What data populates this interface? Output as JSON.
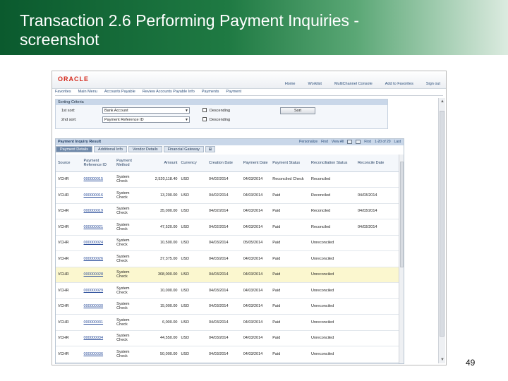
{
  "slide": {
    "title_line1": "Transaction 2.6 Performing Payment Inquiries -",
    "title_line2": "screenshot",
    "page_number": "49"
  },
  "app": {
    "logo": "ORACLE",
    "top_links": [
      "Home",
      "Worklist",
      "MultiChannel Console",
      "Add to Favorites",
      "Sign out"
    ],
    "breadcrumbs": [
      "Favorites",
      "Main Menu",
      "Accounts Payable",
      "Review Accounts Payable Info",
      "Payments",
      "Payment"
    ]
  },
  "sorting": {
    "header": "Sorting Criteria",
    "first_label": "1st sort:",
    "first_value": "Bank Account",
    "second_label": "2nd sort:",
    "second_value": "Payment Reference ID",
    "descending_label": "Descending",
    "sort_button": "Sort"
  },
  "grid": {
    "title": "Payment Inquiry Result",
    "nav": {
      "personalize": "Personalize",
      "find": "Find",
      "view_all": "View All",
      "first": "First",
      "range": "1-20 of 20",
      "last": "Last"
    },
    "tabs": [
      "Payment Details",
      "Additional Info",
      "Vendor Details",
      "Financial Gateway"
    ],
    "columns": [
      "Source",
      "Payment Reference ID",
      "Payment Method",
      "Amount",
      "Currency",
      "Creation Date",
      "Payment Date",
      "Payment Status",
      "Reconciliation Status",
      "Reconcile Date"
    ],
    "rows": [
      {
        "source": "VCHR",
        "ref": "000000015",
        "method": "System Check",
        "amount": "2,520,118.40",
        "currency": "USD",
        "created": "04/02/2014",
        "paid": "04/03/2014",
        "status": "Reconciled Check",
        "recon": "Reconciled",
        "recon_date": ""
      },
      {
        "source": "VCHR",
        "ref": "000000016",
        "method": "System Check",
        "amount": "13,200.00",
        "currency": "USD",
        "created": "04/02/2014",
        "paid": "04/03/2014",
        "status": "Paid",
        "recon": "Reconciled",
        "recon_date": "04/03/2014"
      },
      {
        "source": "VCHR",
        "ref": "000000019",
        "method": "System Check",
        "amount": "35,000.00",
        "currency": "USD",
        "created": "04/02/2014",
        "paid": "04/03/2014",
        "status": "Paid",
        "recon": "Reconciled",
        "recon_date": "04/03/2014"
      },
      {
        "source": "VCHR",
        "ref": "000000021",
        "method": "System Check",
        "amount": "47,520.00",
        "currency": "USD",
        "created": "04/02/2014",
        "paid": "04/03/2014",
        "status": "Paid",
        "recon": "Reconciled",
        "recon_date": "04/03/2014"
      },
      {
        "source": "VCHR",
        "ref": "000000024",
        "method": "System Check",
        "amount": "10,500.00",
        "currency": "USD",
        "created": "04/03/2014",
        "paid": "05/05/2014",
        "status": "Paid",
        "recon": "Unreconciled",
        "recon_date": ""
      },
      {
        "source": "VCHR",
        "ref": "000000026",
        "method": "System Check",
        "amount": "37,375.00",
        "currency": "USD",
        "created": "04/03/2014",
        "paid": "04/03/2014",
        "status": "Paid",
        "recon": "Unreconciled",
        "recon_date": ""
      },
      {
        "source": "VCHR",
        "ref": "000000028",
        "method": "System Check",
        "amount": "308,000.00",
        "currency": "USD",
        "created": "04/03/2014",
        "paid": "04/03/2014",
        "status": "Paid",
        "recon": "Unreconciled",
        "recon_date": "",
        "highlight": true
      },
      {
        "source": "VCHR",
        "ref": "000000029",
        "method": "System Check",
        "amount": "10,000.00",
        "currency": "USD",
        "created": "04/03/2014",
        "paid": "04/03/2014",
        "status": "Paid",
        "recon": "Unreconciled",
        "recon_date": ""
      },
      {
        "source": "VCHR",
        "ref": "000000030",
        "method": "System Check",
        "amount": "15,000.00",
        "currency": "USD",
        "created": "04/03/2014",
        "paid": "04/03/2014",
        "status": "Paid",
        "recon": "Unreconciled",
        "recon_date": ""
      },
      {
        "source": "VCHR",
        "ref": "000000031",
        "method": "System Check",
        "amount": "6,000.00",
        "currency": "USD",
        "created": "04/03/2014",
        "paid": "04/03/2014",
        "status": "Paid",
        "recon": "Unreconciled",
        "recon_date": ""
      },
      {
        "source": "VCHR",
        "ref": "000000034",
        "method": "System Check",
        "amount": "44,550.00",
        "currency": "USD",
        "created": "04/03/2014",
        "paid": "04/03/2014",
        "status": "Paid",
        "recon": "Unreconciled",
        "recon_date": ""
      },
      {
        "source": "VCHR",
        "ref": "000000036",
        "method": "System Check",
        "amount": "50,000.00",
        "currency": "USD",
        "created": "04/03/2014",
        "paid": "04/03/2014",
        "status": "Paid",
        "recon": "Unreconciled",
        "recon_date": ""
      }
    ]
  }
}
